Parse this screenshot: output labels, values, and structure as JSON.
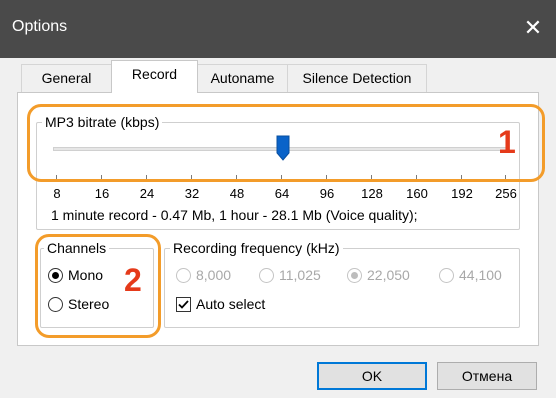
{
  "window": {
    "title": "Options",
    "close_glyph": "✕"
  },
  "tabs": [
    {
      "label": "General",
      "active": false
    },
    {
      "label": "Record",
      "active": true
    },
    {
      "label": "Autoname",
      "active": false
    },
    {
      "label": "Silence Detection",
      "active": false
    }
  ],
  "bitrate": {
    "label": "MP3 bitrate (kbps)",
    "scale": [
      "8",
      "16",
      "24",
      "32",
      "48",
      "64",
      "96",
      "128",
      "160",
      "192",
      "256"
    ],
    "selected": "64",
    "info": "1 minute record - 0.47 Mb, 1 hour - 28.1 Mb (Voice quality);"
  },
  "channels": {
    "label": "Channels",
    "options": [
      {
        "label": "Mono",
        "checked": true
      },
      {
        "label": "Stereo",
        "checked": false
      }
    ]
  },
  "frequency": {
    "label": "Recording frequency (kHz)",
    "options": [
      {
        "label": "8,000",
        "checked": false
      },
      {
        "label": "11,025",
        "checked": false
      },
      {
        "label": "22,050",
        "checked": true
      },
      {
        "label": "44,100",
        "checked": false
      }
    ],
    "auto_select_label": "Auto select",
    "auto_select_checked": true
  },
  "buttons": {
    "ok": "OK",
    "cancel": "Отмена"
  },
  "annotations": {
    "marker_1": "1",
    "marker_2": "2",
    "box_color": "#f39c2a",
    "number_color": "#e53a1a"
  },
  "colors": {
    "titlebar": "#4a4a4a",
    "thumb": "#0a63c9",
    "default_button_border": "#0078d7"
  }
}
